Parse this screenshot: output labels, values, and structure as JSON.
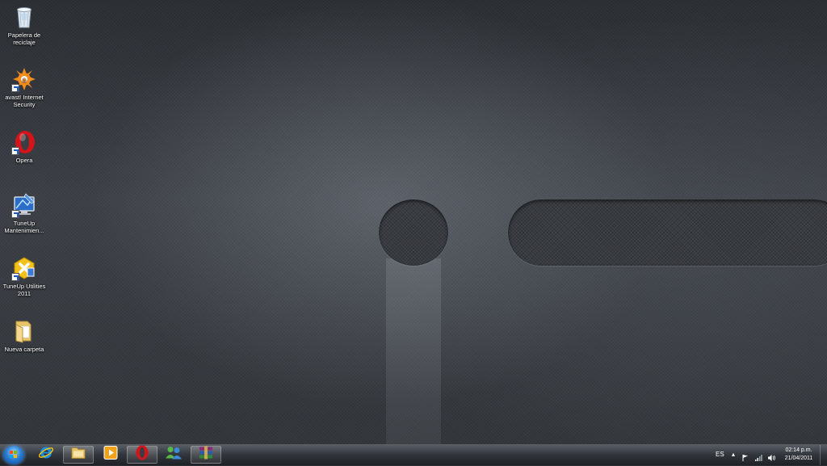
{
  "desktop": {
    "icons": [
      {
        "label": "Papelera de reciclaje",
        "icon": "recycle-bin-icon"
      },
      {
        "label": "avast! Internet Security",
        "icon": "avast-icon"
      },
      {
        "label": "Opera",
        "icon": "opera-icon"
      },
      {
        "label": "TuneUp Mantenimien...",
        "icon": "tuneup-maintenance-icon"
      },
      {
        "label": "TuneUp Utilities 2011",
        "icon": "tuneup-utilities-icon"
      },
      {
        "label": "Nueva carpeta",
        "icon": "folder-icon"
      }
    ]
  },
  "taskbar": {
    "pinned": [
      {
        "name": "Internet Explorer",
        "icon": "internet-explorer-icon"
      },
      {
        "name": "Windows Explorer",
        "icon": "windows-explorer-icon"
      },
      {
        "name": "Windows Media Player",
        "icon": "media-player-icon"
      },
      {
        "name": "Opera",
        "icon": "opera-icon"
      },
      {
        "name": "Windows Live Messenger",
        "icon": "messenger-icon"
      },
      {
        "name": "WinRAR",
        "icon": "winrar-icon"
      }
    ],
    "tray": {
      "language": "ES",
      "time": "02:14 p.m.",
      "date": "21/04/2011"
    }
  },
  "colors": {
    "accent": "#2b7fd6",
    "opera_red": "#d4141b"
  }
}
